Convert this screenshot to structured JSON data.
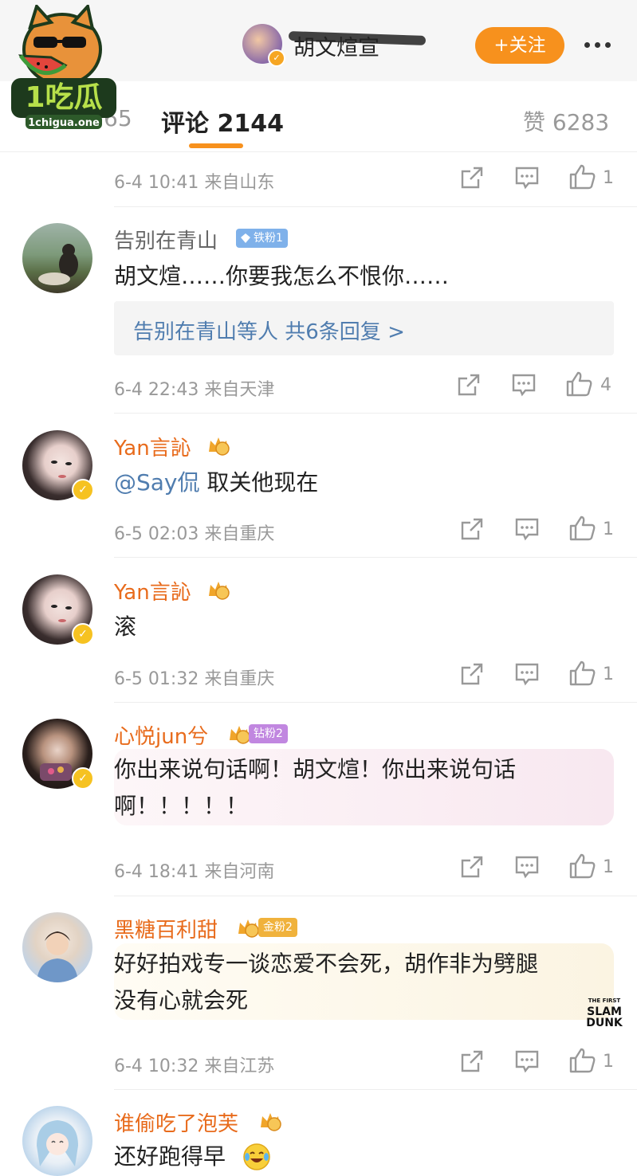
{
  "header": {
    "account_name": "胡文煊宣",
    "follow_label": "+关注"
  },
  "tabs": {
    "prev_count": "65",
    "comments": "评论 2144",
    "likes": "赞 6283"
  },
  "logo": {
    "text": "1吃瓜",
    "site": "1chigua.one"
  },
  "first_meta": {
    "time": "6-4 10:41 来自山东",
    "likes": "1"
  },
  "comments": [
    {
      "user": "告别在青山",
      "badge": "铁粉1",
      "text": "胡文煊……你要我怎么不恨你……",
      "reply_summary": "告别在青山等人 共6条回复 >",
      "time": "6-4 22:43 来自天津",
      "likes": "4"
    },
    {
      "user": "Yan言訫",
      "mention": "@Say侃",
      "text": " 取关他现在",
      "time": "6-5 02:03 来自重庆",
      "likes": "1"
    },
    {
      "user": "Yan言訫",
      "text": "滚",
      "time": "6-5 01:32 来自重庆",
      "likes": "1"
    },
    {
      "user": "心悦jun兮",
      "badge": "钻粉2",
      "text_line1": "你出来说句话啊！胡文煊！你出来说句话",
      "text_line2": "啊！！！！！",
      "time": "6-4 18:41 来自河南",
      "likes": "1"
    },
    {
      "user": "黑糖百利甜",
      "badge": "金粉2",
      "text_line1": "好好拍戏专一谈恋爱不会死，胡作非为劈腿",
      "text_line2": "没有心就会死",
      "time": "6-4 10:32 来自江苏",
      "likes": "1"
    },
    {
      "user": "谁偷吃了泡芙",
      "text": "还好跑得早"
    }
  ],
  "watermark": {
    "line1": "THE FIRST",
    "line2": "SLAM",
    "line3": "DUNK"
  },
  "colors": {
    "accent": "#f7911d",
    "link": "#507daf",
    "vip_name": "#e86b1c"
  }
}
